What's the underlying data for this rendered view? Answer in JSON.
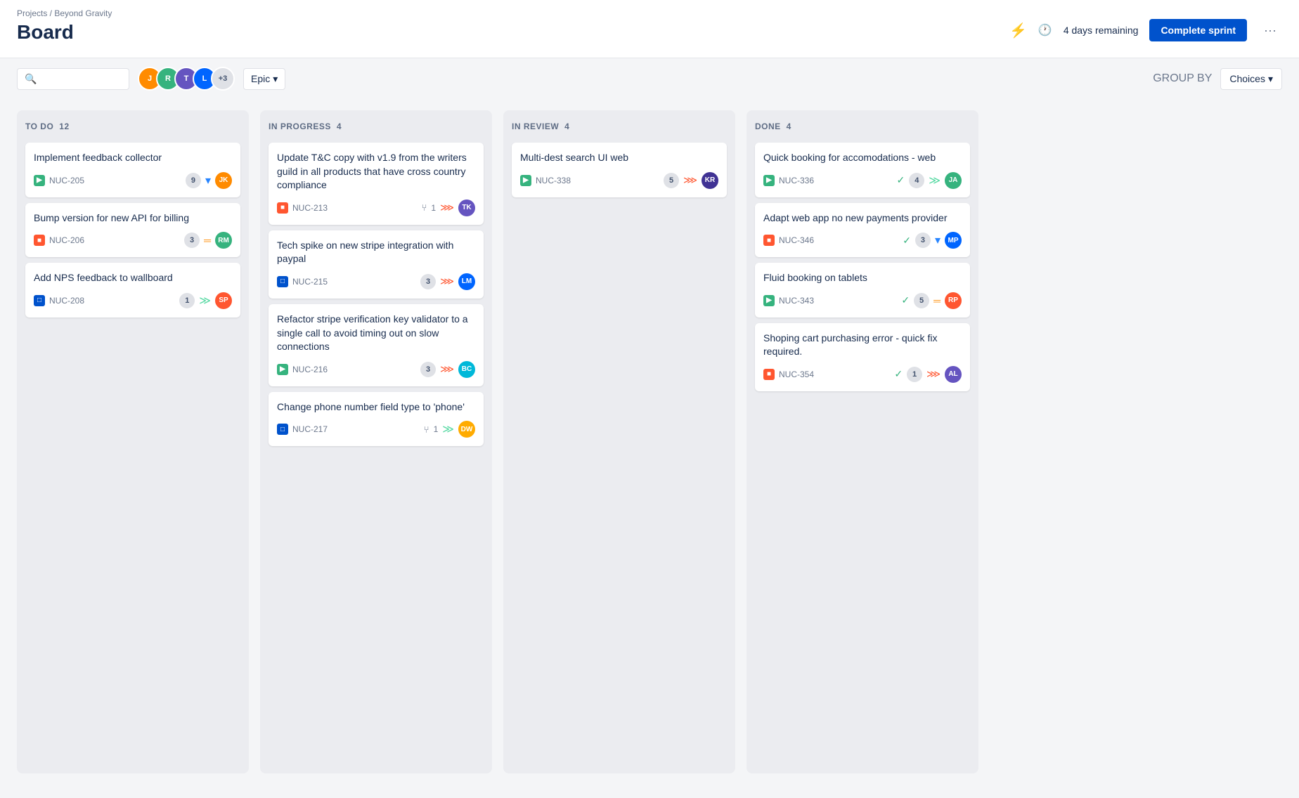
{
  "breadcrumb": "Projects / Beyond Gravity",
  "page_title": "Board",
  "sprint": {
    "days_remaining": "4 days remaining",
    "complete_btn": "Complete sprint",
    "more_btn": "···"
  },
  "toolbar": {
    "search_placeholder": "",
    "epic_label": "Epic",
    "group_by_label": "GROUP BY",
    "choices_label": "Choices",
    "avatars_extra": "+3"
  },
  "columns": [
    {
      "id": "todo",
      "title": "TO DO",
      "count": 12,
      "cards": [
        {
          "id": "card-205",
          "title": "Implement feedback collector",
          "issue_id": "NUC-205",
          "issue_type": "story",
          "badge": "9",
          "priority": "low",
          "priority_symbol": "▾",
          "avatar_initials": "JK",
          "avatar_class": "av1"
        },
        {
          "id": "card-206",
          "title": "Bump version for new API for billing",
          "issue_id": "NUC-206",
          "issue_type": "bug",
          "badge": "3",
          "priority": "medium",
          "priority_symbol": "═",
          "avatar_initials": "RM",
          "avatar_class": "av2"
        },
        {
          "id": "card-208",
          "title": "Add NPS feedback to wallboard",
          "issue_id": "NUC-208",
          "issue_type": "task",
          "badge": "1",
          "priority": "lowest",
          "priority_symbol": "≫",
          "avatar_initials": "SP",
          "avatar_class": "av5"
        }
      ]
    },
    {
      "id": "in-progress",
      "title": "IN PROGRESS",
      "count": 4,
      "cards": [
        {
          "id": "card-213",
          "title": "Update T&C copy with v1.9 from the writers guild in all products that have cross country compliance",
          "issue_id": "NUC-213",
          "issue_type": "bug",
          "badge": null,
          "branch_count": "1",
          "priority": "high",
          "priority_symbol": "⋙",
          "avatar_initials": "TK",
          "avatar_class": "av3"
        },
        {
          "id": "card-215",
          "title": "Tech spike on new stripe integration with paypal",
          "issue_id": "NUC-215",
          "issue_type": "task",
          "badge": "3",
          "priority": "high",
          "priority_symbol": "⋙",
          "avatar_initials": "LM",
          "avatar_class": "av4"
        },
        {
          "id": "card-216",
          "title": "Refactor stripe verification key validator to a single call to avoid timing out on slow connections",
          "issue_id": "NUC-216",
          "issue_type": "story",
          "badge": "3",
          "priority": "high",
          "priority_symbol": "⋙",
          "avatar_initials": "BC",
          "avatar_class": "av6"
        },
        {
          "id": "card-217",
          "title": "Change phone number field type to 'phone'",
          "issue_id": "NUC-217",
          "issue_type": "task",
          "badge": null,
          "branch_count": "1",
          "priority": "lowest",
          "priority_symbol": "≫",
          "avatar_initials": "DW",
          "avatar_class": "av7"
        }
      ]
    },
    {
      "id": "in-review",
      "title": "IN REVIEW",
      "count": 4,
      "cards": [
        {
          "id": "card-338",
          "title": "Multi-dest search UI web",
          "issue_id": "NUC-338",
          "issue_type": "story",
          "badge": "5",
          "priority": "high",
          "priority_symbol": "⋙",
          "avatar_initials": "KR",
          "avatar_class": "av8"
        }
      ]
    },
    {
      "id": "done",
      "title": "DONE",
      "count": 4,
      "cards": [
        {
          "id": "card-336",
          "title": "Quick booking for accomodations - web",
          "issue_id": "NUC-336",
          "issue_type": "story",
          "badge": "4",
          "has_check": true,
          "priority": "lowest",
          "priority_symbol": "≫",
          "avatar_initials": "JA",
          "avatar_class": "av2"
        },
        {
          "id": "card-346",
          "title": "Adapt web app no new payments provider",
          "issue_id": "NUC-346",
          "issue_type": "bug",
          "badge": "3",
          "has_check": true,
          "priority": "low",
          "priority_symbol": "▾",
          "avatar_initials": "MP",
          "avatar_class": "av4"
        },
        {
          "id": "card-343",
          "title": "Fluid booking on tablets",
          "issue_id": "NUC-343",
          "issue_type": "story",
          "badge": "5",
          "has_check": true,
          "priority": "medium",
          "priority_symbol": "═",
          "avatar_initials": "RP",
          "avatar_class": "av5"
        },
        {
          "id": "card-354",
          "title": "Shoping cart purchasing error - quick fix required.",
          "issue_id": "NUC-354",
          "issue_type": "bug",
          "badge": "1",
          "has_check": true,
          "priority": "high",
          "priority_symbol": "⋙",
          "avatar_initials": "AL",
          "avatar_class": "av3"
        }
      ]
    }
  ]
}
